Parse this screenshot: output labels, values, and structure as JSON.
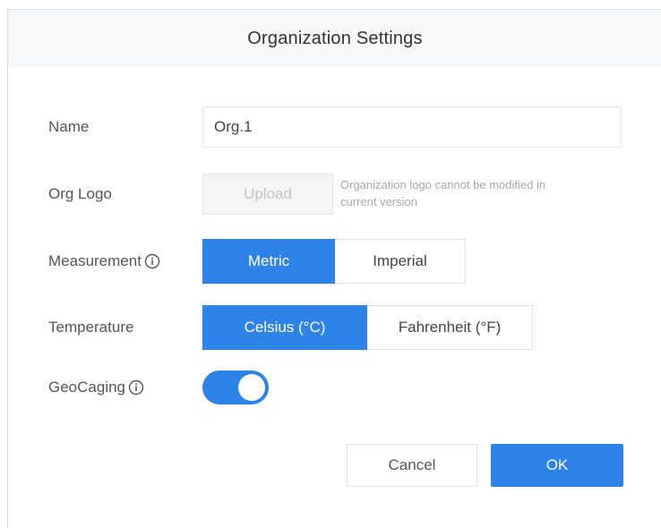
{
  "dialog": {
    "title": "Organization Settings"
  },
  "form": {
    "name": {
      "label": "Name",
      "value": "Org.1"
    },
    "logo": {
      "label": "Org Logo",
      "upload_label": "Upload",
      "hint": "Organization logo cannot be modified in current version"
    },
    "measurement": {
      "label": "Measurement",
      "options": [
        "Metric",
        "Imperial"
      ],
      "selected": "Metric"
    },
    "temperature": {
      "label": "Temperature",
      "options": [
        "Celsius (°C)",
        "Fahrenheit (°F)"
      ],
      "selected": "Celsius (°C)"
    },
    "geocaging": {
      "label": "GeoCaging",
      "enabled": true
    }
  },
  "footer": {
    "cancel_label": "Cancel",
    "ok_label": "OK"
  },
  "colors": {
    "accent": "#2e83e8",
    "header_bg": "#f7f8fa"
  },
  "icons": {
    "info": "info-circle-icon"
  }
}
